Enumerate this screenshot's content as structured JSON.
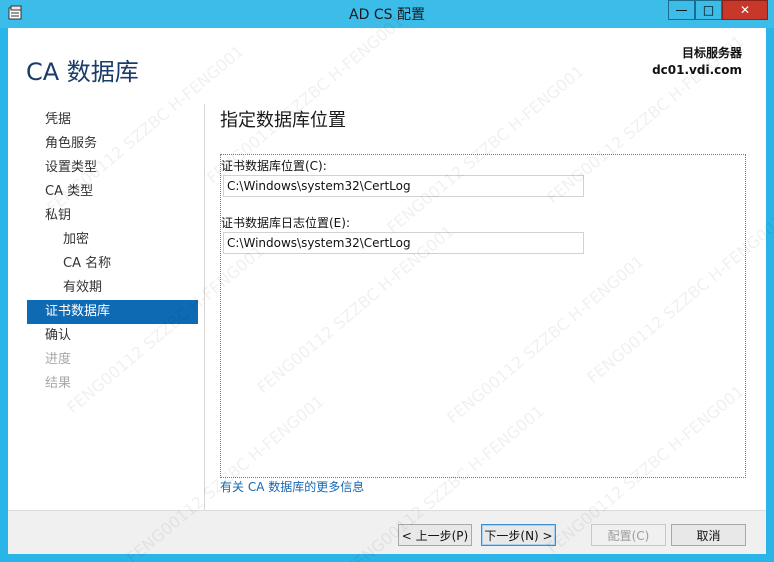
{
  "window": {
    "title": "AD CS 配置",
    "minimize_glyph": "—",
    "maximize_glyph": "□",
    "close_glyph": "✕"
  },
  "header": {
    "page_title": "CA 数据库",
    "target_server_label": "目标服务器",
    "target_server_value": "dc01.vdi.com"
  },
  "nav": {
    "items": [
      {
        "label": "凭据",
        "state": "normal",
        "level": 0
      },
      {
        "label": "角色服务",
        "state": "normal",
        "level": 0
      },
      {
        "label": "设置类型",
        "state": "normal",
        "level": 0
      },
      {
        "label": "CA 类型",
        "state": "normal",
        "level": 0
      },
      {
        "label": "私钥",
        "state": "normal",
        "level": 0
      },
      {
        "label": "加密",
        "state": "normal",
        "level": 1
      },
      {
        "label": "CA 名称",
        "state": "normal",
        "level": 1
      },
      {
        "label": "有效期",
        "state": "normal",
        "level": 1
      },
      {
        "label": "证书数据库",
        "state": "active",
        "level": 0
      },
      {
        "label": "确认",
        "state": "normal",
        "level": 0
      },
      {
        "label": "进度",
        "state": "disabled",
        "level": 0
      },
      {
        "label": "结果",
        "state": "disabled",
        "level": 0
      }
    ]
  },
  "main": {
    "heading": "指定数据库位置",
    "db_location_label": "证书数据库位置(C):",
    "db_location_value": "C:\\Windows\\system32\\CertLog",
    "log_location_label": "证书数据库日志位置(E):",
    "log_location_value": "C:\\Windows\\system32\\CertLog",
    "more_info_link": "有关 CA 数据库的更多信息"
  },
  "footer": {
    "prev_label": "< 上一步(P)",
    "next_label": "下一步(N) >",
    "configure_label": "配置(C)",
    "cancel_label": "取消"
  },
  "watermark": {
    "text": "FENG00112 SZZBC H-FENG001"
  },
  "colors": {
    "titlebar": "#3cbde9",
    "accent": "#0f6ab4",
    "link": "#1467b3",
    "close_button": "#c7382b"
  }
}
